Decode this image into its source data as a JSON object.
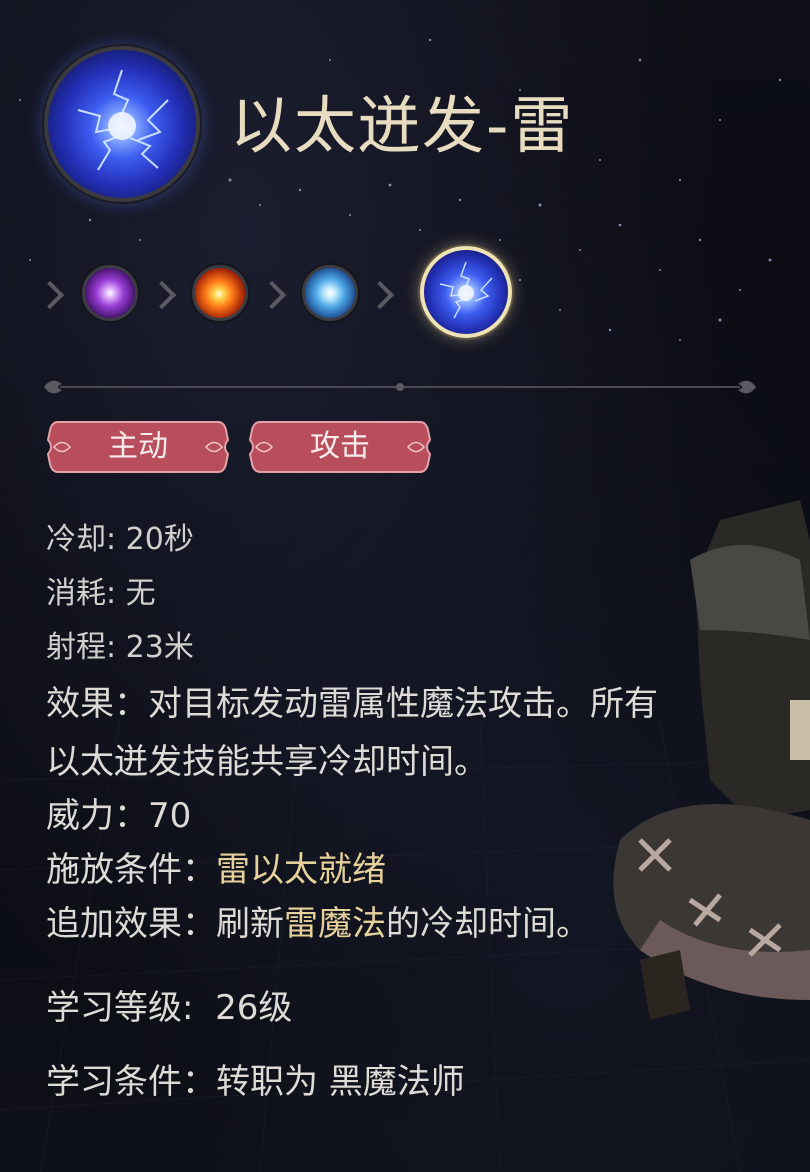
{
  "skill": {
    "name": "以太迸发-雷",
    "icon": "thunder-orb-icon"
  },
  "skill_chain": [
    {
      "icon": "arcane-orb-icon",
      "selected": false
    },
    {
      "icon": "fire-orb-icon",
      "selected": false
    },
    {
      "icon": "ice-orb-icon",
      "selected": false
    },
    {
      "icon": "thunder-orb-icon",
      "selected": true
    }
  ],
  "tags": [
    "主动",
    "攻击"
  ],
  "stats": {
    "cooldown": "冷却: 20秒",
    "cost": "消耗: 无",
    "range": "射程: 23米"
  },
  "effect": {
    "line1": "效果：对目标发动雷属性魔法攻击。所有",
    "line2": "以太迸发技能共享冷却时间。"
  },
  "power": "威力：70",
  "cast_condition": {
    "label": "施放条件：",
    "value": "雷以太就绪"
  },
  "bonus_effect": {
    "label": "追加效果：刷新",
    "highlight": "雷魔法",
    "suffix": "的冷却时间。"
  },
  "learn_level": "学习等级:  26级",
  "learn_condition": "学习条件：转职为 黑魔法师",
  "colors": {
    "title": "#e8dcc0",
    "highlight": "#e6d19a",
    "tag": "#b84e5c",
    "background": "#0a0b11"
  }
}
